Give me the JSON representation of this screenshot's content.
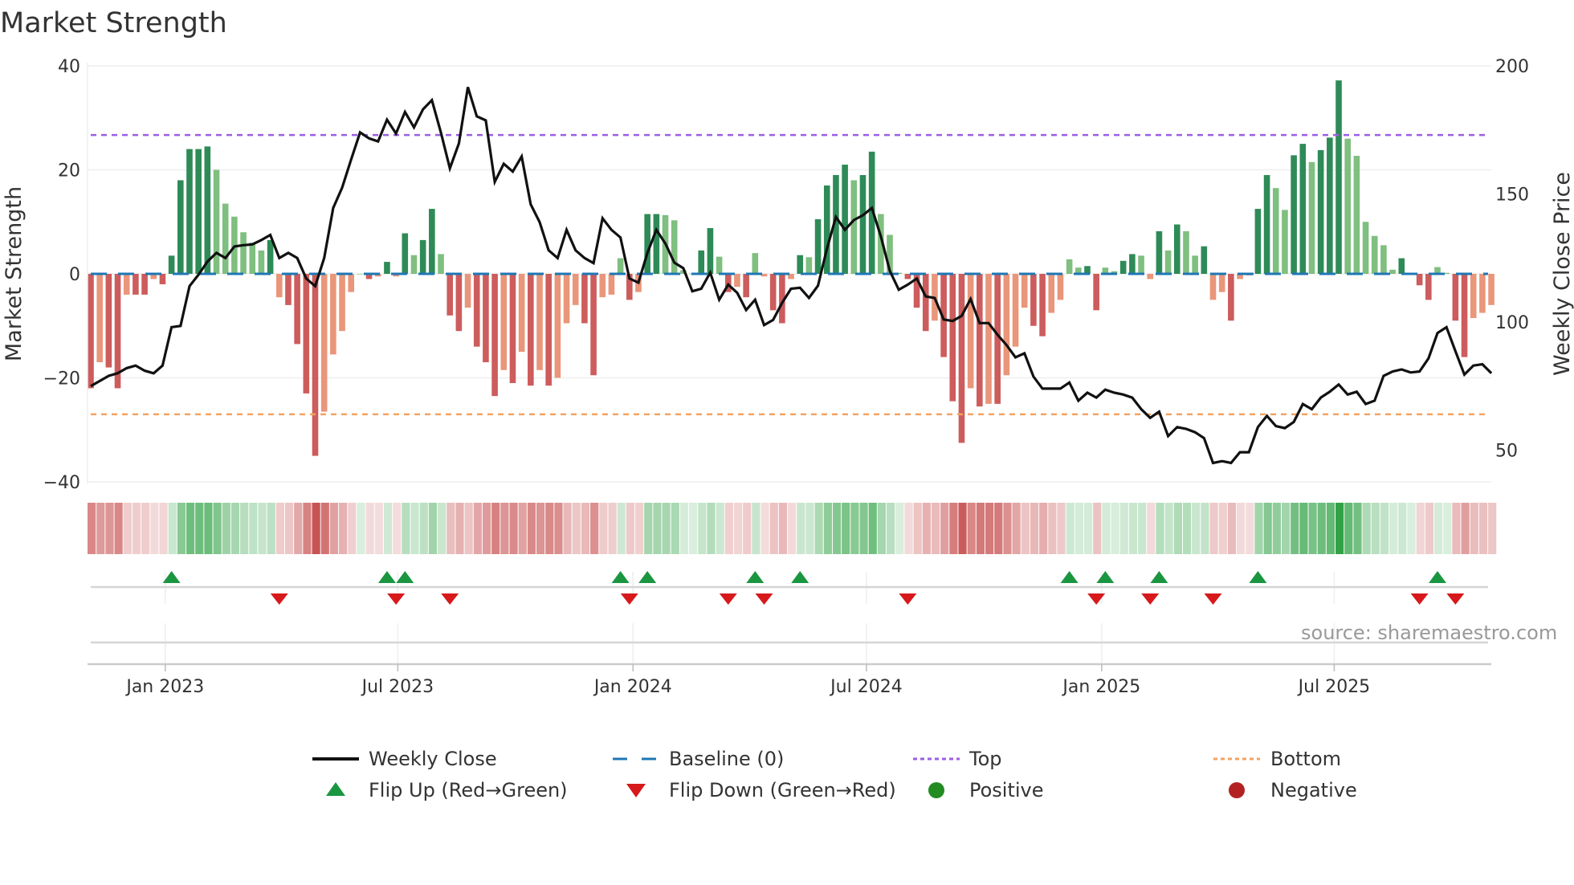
{
  "chart_data": {
    "type": "bar",
    "title": "Market Strength",
    "ylabel": "Market Strength",
    "y2label": "Weekly Close Price",
    "ylim": [
      -40,
      40
    ],
    "y2lim": [
      37.4,
      200
    ],
    "yticks": [
      40,
      20,
      0,
      -20,
      -40
    ],
    "ytick_labels": [
      "40",
      "20",
      "0",
      "−20",
      "−40"
    ],
    "y2ticks": [
      200,
      150,
      100,
      50
    ],
    "y2tick_labels": [
      "200",
      "150",
      "100",
      "50"
    ],
    "xtick_labels": [
      "Jan 2023",
      "Jul 2023",
      "Jan 2024",
      "Jul 2024",
      "Jan 2025",
      "Jul 2025"
    ],
    "xtick_week_index": [
      8.3,
      34.2,
      60.4,
      86.4,
      112.6,
      138.5
    ],
    "top_level": 26.7,
    "bottom_level": -27,
    "baseline": 0,
    "grid": true,
    "source": "source: sharemaestro.com",
    "colors": {
      "strong_pos": "#2e8b57",
      "weak_pos": "#7fbf7f",
      "strong_neg": "#cd5c5c",
      "weak_neg": "#e9967a",
      "top": "#9b5de5",
      "bottom": "#f4a261",
      "baseline": "#1f77b4",
      "close": "#111111",
      "flip_up": "#1a9641",
      "flip_down": "#d7191c",
      "positive": "#228b22",
      "negative": "#b22222"
    },
    "strength": [
      -22,
      -17,
      -18,
      -22,
      -4,
      -4,
      -4,
      -1,
      -2,
      3.5,
      18,
      24,
      24,
      24.5,
      20,
      13.5,
      11,
      8,
      6,
      4.5,
      6.5,
      -4.5,
      -6,
      -13.5,
      -23,
      -35,
      -26.5,
      -15.5,
      -11,
      -3.5,
      0,
      -1,
      -0.5,
      2.3,
      -0.5,
      7.8,
      3.6,
      6.5,
      12.5,
      3.8,
      -8,
      -11,
      -6.5,
      -14,
      -17,
      -23.5,
      -18.5,
      -21,
      -15,
      -21.5,
      -18.5,
      -21.5,
      -20,
      -9.5,
      -6,
      -9.5,
      -19.5,
      -4.5,
      -4,
      3,
      -5,
      -3.5,
      11.5,
      11.5,
      11.3,
      10.3,
      0.7,
      0,
      4.5,
      8.8,
      3.3,
      -3.5,
      -2.5,
      -4.5,
      4,
      -0.5,
      -7,
      -9.5,
      -1,
      3.6,
      3.2,
      10.5,
      17,
      19,
      21,
      18,
      19,
      23.5,
      11.5,
      7.5,
      0.2,
      -1,
      -6.5,
      -11,
      -9,
      -16,
      -24.5,
      -32.5,
      -22,
      -25.5,
      -25,
      -25,
      -19.5,
      -14,
      -6.5,
      -10,
      -12,
      -7.5,
      -5,
      2.8,
      1.2,
      1.5,
      -7,
      1.2,
      0.5,
      2.5,
      3.8,
      3.5,
      -1,
      8.2,
      4.5,
      9.5,
      8.2,
      3.5,
      5.3,
      -5,
      -3.5,
      -9,
      -1,
      -0.3,
      12.5,
      19,
      16.5,
      12.3,
      22.8,
      25,
      21.5,
      23.8,
      26.2,
      37.2,
      26,
      22.7,
      10,
      7.3,
      5.5,
      0.8,
      3,
      0,
      -2.2,
      -5,
      1.3,
      0.2,
      -9,
      -16,
      -8.5,
      -7.5,
      -6
    ],
    "weekly_close": [
      75,
      77,
      79,
      80,
      82,
      83,
      81,
      80,
      83,
      98,
      98.5,
      114,
      118.5,
      123.6,
      127,
      125,
      129.5,
      130,
      130.3,
      132,
      134,
      125,
      127,
      125,
      117,
      114,
      125,
      144.5,
      152.4,
      163.4,
      174,
      171.7,
      170.5,
      179,
      173.6,
      182,
      176,
      183,
      186.6,
      174,
      160,
      169.7,
      191.7,
      180.3,
      178.7,
      154.7,
      161.8,
      158.7,
      164.6,
      146,
      139,
      128,
      125,
      136,
      128,
      125,
      123,
      140.5,
      136,
      133,
      117,
      115.4,
      127,
      136,
      130.7,
      123.2,
      121,
      112,
      113,
      119.3,
      108.7,
      114.6,
      111.4,
      104.7,
      108.7,
      98.8,
      100.8,
      107.5,
      113,
      113.4,
      109.4,
      114.2,
      128.7,
      141,
      136,
      139.8,
      141.7,
      144.5,
      133.5,
      120,
      112.6,
      114.6,
      117,
      110,
      109.4,
      101,
      100.4,
      102.4,
      109,
      99.6,
      99.6,
      95,
      91,
      86.2,
      87.8,
      78.7,
      74,
      74,
      74,
      76.4,
      69.3,
      72.4,
      70.5,
      73.6,
      72.4,
      71.7,
      70.5,
      66,
      62.6,
      65,
      55.5,
      59,
      58.3,
      57,
      54.7,
      45,
      45.7,
      45,
      49.2,
      49.2,
      59,
      63.4,
      59.4,
      58.6,
      61,
      68,
      66,
      70.5,
      72.8,
      75.6,
      71.7,
      72.8,
      68,
      69.3,
      79,
      80.7,
      81.5,
      80.3,
      80.7,
      85.8,
      95.7,
      98,
      88.6,
      79.5,
      83,
      83.5,
      80
    ],
    "flip_up_index": [
      9,
      33,
      35,
      59,
      62,
      74,
      79,
      109,
      113,
      119,
      130,
      150
    ],
    "flip_down_index": [
      21,
      34,
      40,
      60,
      71,
      75,
      91,
      112,
      118,
      125,
      148,
      152
    ],
    "legend": {
      "placement": "bottom",
      "items": [
        {
          "label": "Weekly Close",
          "kind": "line"
        },
        {
          "label": "Baseline (0)",
          "kind": "dash"
        },
        {
          "label": "Top",
          "kind": "dot-top"
        },
        {
          "label": "Bottom",
          "kind": "dot-bottom"
        },
        {
          "label": "Flip Up (Red→Green)",
          "kind": "tri-up"
        },
        {
          "label": "Flip Down (Green→Red)",
          "kind": "tri-down"
        },
        {
          "label": "Positive",
          "kind": "circle-pos"
        },
        {
          "label": "Negative",
          "kind": "circle-neg"
        }
      ]
    }
  }
}
